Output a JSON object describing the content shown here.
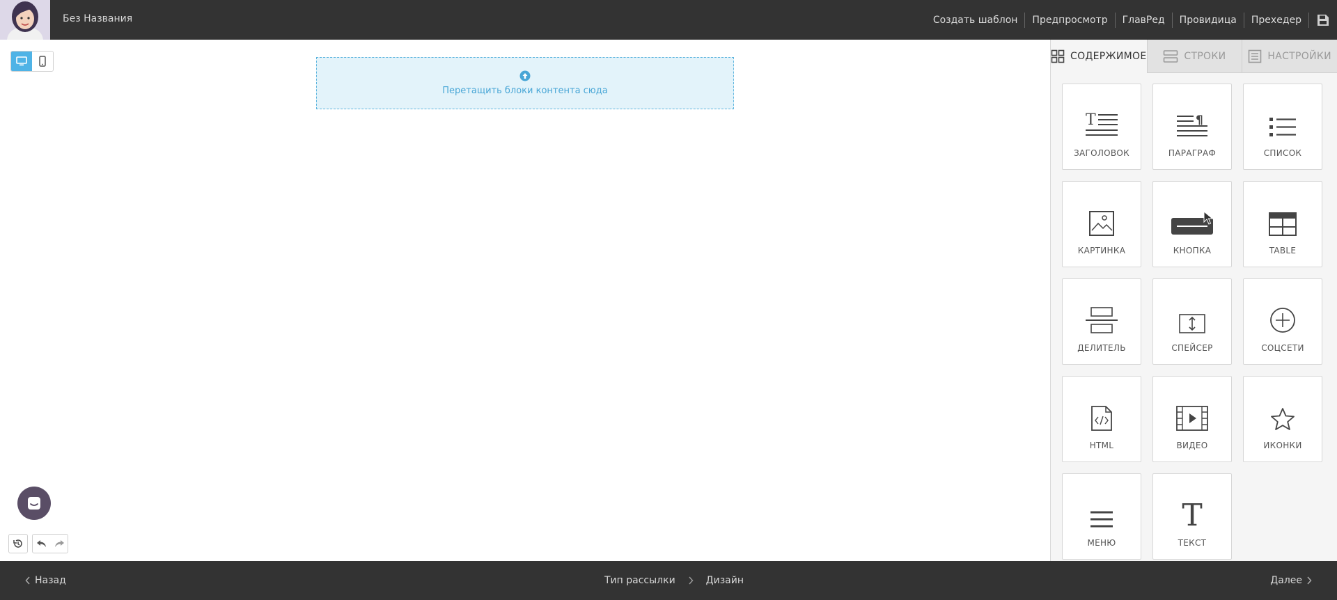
{
  "header": {
    "doc_title": "Без Названия",
    "menu": {
      "create_template": "Создать шаблон",
      "preview": "Предпросмотр",
      "glavred": "ГлавРед",
      "providitsa": "Провидица",
      "preheader": "Прехедер"
    }
  },
  "canvas": {
    "drop_text": "Перетащить блоки контента сюда"
  },
  "panel": {
    "tabs": {
      "content": "СОДЕРЖИМОЕ",
      "rows": "СТРОКИ",
      "settings": "НАСТРОЙКИ"
    },
    "blocks": {
      "heading": "ЗАГОЛОВОК",
      "paragraph": "ПАРАГРАФ",
      "list": "СПИСОК",
      "image": "КАРТИНКА",
      "button": "КНОПКА",
      "table": "TABLE",
      "divider": "ДЕЛИТЕЛЬ",
      "spacer": "СПЕЙСЕР",
      "social": "СОЦСЕТИ",
      "html": "HTML",
      "video": "ВИДЕО",
      "icons": "ИКОНКИ",
      "menu": "МЕНЮ",
      "text": "ТЕКСТ"
    }
  },
  "footer": {
    "back": "Назад",
    "step1": "Тип рассылки",
    "step2": "Дизайн",
    "next": "Далее"
  },
  "colors": {
    "bar": "#333333",
    "accent": "#4fb3e6",
    "dropzone_bg": "#e3f3fa",
    "chat": "#5a4e66"
  }
}
